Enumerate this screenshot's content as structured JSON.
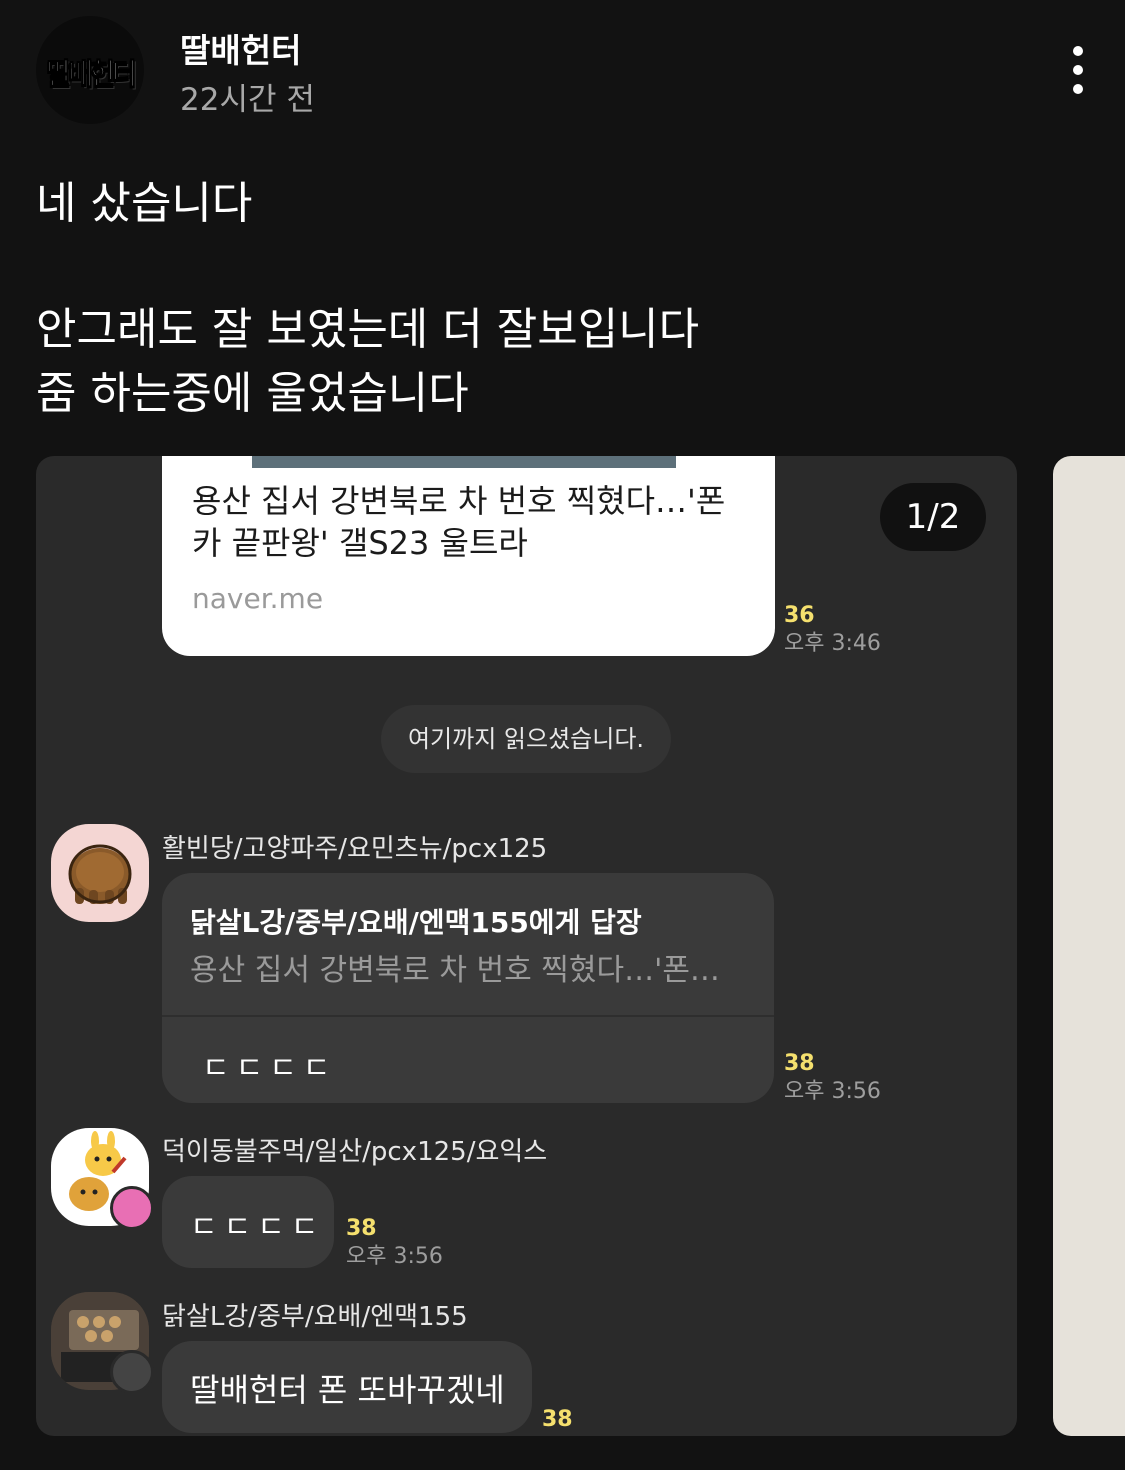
{
  "header": {
    "avatar_logo": "딸배헌터",
    "author": "딸배헌터",
    "time": "22시간 전"
  },
  "post": {
    "line1": "네 샀습니다",
    "line2": "안그래도 잘 보였는데 더 잘보입니다",
    "line3": "줌 하는중에 울었습니다"
  },
  "carousel": {
    "page_indicator": "1/2",
    "link_card": {
      "title": "용산 집서 강변북로 차 번호 찍혔다…'폰카 끝판왕' 갤S23 울트라",
      "domain": "naver.me",
      "count": "36",
      "time": "오후 3:46"
    },
    "read_marker": "여기까지 읽으셨습니다.",
    "messages": [
      {
        "sender": "활빈당/고양파주/요민츠뉴/pcx125",
        "reply_to": "닭살L강/중부/요배/엔맥155에게 답장",
        "reply_quote": "용산 집서 강변북로 차 번호 찍혔다…'폰…",
        "text": "ㄷㄷㄷㄷ",
        "count": "38",
        "time": "오후 3:56"
      },
      {
        "sender": "덕이동불주먹/일산/pcx125/요익스",
        "text": "ㄷㄷㄷㄷ",
        "count": "38",
        "time": "오후 3:56"
      },
      {
        "sender": "닭살L강/중부/요배/엔맥155",
        "text": "딸배헌터 폰 또바꾸겠네",
        "count": "38"
      }
    ]
  },
  "colors": {
    "background": "#121212",
    "bubble": "#3a3a3a",
    "unread_count": "#f5e06e"
  }
}
